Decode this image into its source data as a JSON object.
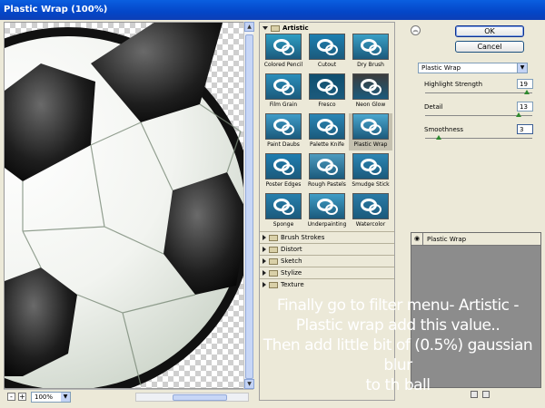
{
  "window": {
    "title": "Plastic Wrap (100%)"
  },
  "preview": {
    "zoom": "100%",
    "zoom_out": "-",
    "zoom_in": "+"
  },
  "gallery": {
    "open_category": "Artistic",
    "filters": [
      {
        "label": "Colored Pencil",
        "bg": "#2f9fc4"
      },
      {
        "label": "Cutout",
        "bg": "#1c7fb0"
      },
      {
        "label": "Dry Brush",
        "bg": "#3aa0c6"
      },
      {
        "label": "Film Grain",
        "bg": "#2b8fbb"
      },
      {
        "label": "Fresco",
        "bg": "#0f4f6f"
      },
      {
        "label": "Neon Glow",
        "bg": "#3c3c3c"
      },
      {
        "label": "Paint Daubs",
        "bg": "#3f9cc8"
      },
      {
        "label": "Palette Knife",
        "bg": "#2a86b5"
      },
      {
        "label": "Plastic Wrap",
        "bg": "#4aa7cf",
        "selected": true
      },
      {
        "label": "Poster Edges",
        "bg": "#1f7eb0"
      },
      {
        "label": "Rough Pastels",
        "bg": "#4d9bbf"
      },
      {
        "label": "Smudge Stick",
        "bg": "#2c86b4"
      },
      {
        "label": "Sponge",
        "bg": "#2780ad"
      },
      {
        "label": "Underpainting",
        "bg": "#3f9dc6"
      },
      {
        "label": "Watercolor",
        "bg": "#2a7ba6"
      }
    ],
    "categories": [
      "Brush Strokes",
      "Distort",
      "Sketch",
      "Stylize",
      "Texture"
    ]
  },
  "buttons": {
    "ok": "OK",
    "cancel": "Cancel",
    "collapse": "︽"
  },
  "settings": {
    "filter": "Plastic Wrap",
    "params": [
      {
        "label": "Highlight Strength",
        "value": "19",
        "level": 0.95
      },
      {
        "label": "Detail",
        "value": "13",
        "level": 0.87
      },
      {
        "label": "Smoothness",
        "value": "3",
        "level": 0.13
      }
    ]
  },
  "effects": {
    "layer": "Plastic Wrap"
  },
  "annotation": {
    "lines": [
      "Finally go to filter menu- Artistic -",
      "Plastic wrap add this value..",
      "Then add little bit of (0.5%) gaussian blur",
      "to th ball"
    ]
  }
}
